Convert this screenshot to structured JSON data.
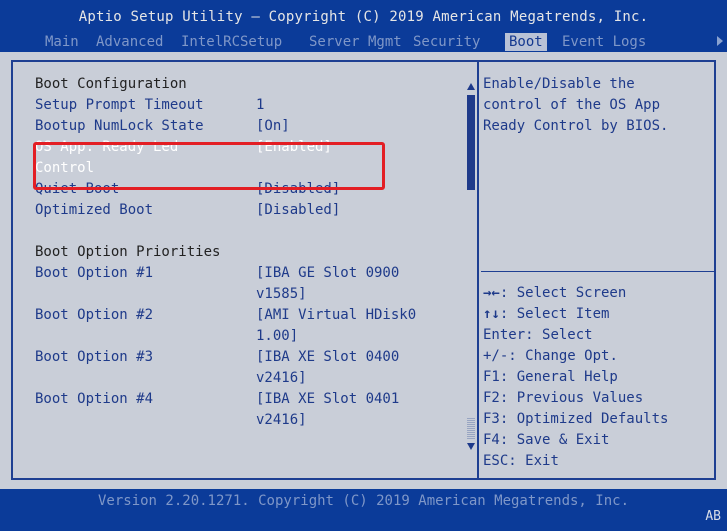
{
  "header": {
    "title": "Aptio Setup Utility – Copyright (C) 2019 American Megatrends, Inc.",
    "tabs": [
      {
        "label": "Main"
      },
      {
        "label": "Advanced"
      },
      {
        "label": "IntelRCSetup"
      },
      {
        "label": "Server Mgmt"
      },
      {
        "label": "Security"
      },
      {
        "label": "Boot"
      },
      {
        "label": "Event Logs"
      }
    ],
    "active_tab": "Boot"
  },
  "boot": {
    "section1_title": "Boot Configuration",
    "items": [
      {
        "label": "Setup Prompt Timeout",
        "value": "1"
      },
      {
        "label": "Bootup NumLock State",
        "value": "[On]"
      },
      {
        "label": "OS App. Ready Led",
        "label2": "Control",
        "value": "[Enabled]"
      },
      {
        "label": "Quiet Boot",
        "value": "[Disabled]"
      },
      {
        "label": "Optimized Boot",
        "value": "[Disabled]"
      }
    ],
    "section2_title": "Boot Option Priorities",
    "options": [
      {
        "label": "Boot Option #1",
        "value": "[IBA GE Slot 0900",
        "value2": "v1585]"
      },
      {
        "label": "Boot Option #2",
        "value": "[AMI Virtual HDisk0",
        "value2": "1.00]"
      },
      {
        "label": "Boot Option #3",
        "value": "[IBA XE Slot 0400",
        "value2": "v2416]"
      },
      {
        "label": "Boot Option #4",
        "value": "[IBA XE Slot 0401",
        "value2": "v2416]"
      }
    ]
  },
  "help": {
    "lines": [
      "Enable/Disable the",
      "control of the OS App",
      "Ready Control by BIOS."
    ],
    "keys": [
      {
        "key": "→←",
        "text": ": Select Screen"
      },
      {
        "key": "↑↓",
        "text": ": Select Item"
      },
      {
        "key": "Enter",
        "text": ": Select"
      },
      {
        "key": "+/-",
        "text": ": Change Opt."
      },
      {
        "key": "F1",
        "text": ": General Help"
      },
      {
        "key": "F2",
        "text": ": Previous Values"
      },
      {
        "key": "F3",
        "text": ": Optimized Defaults"
      },
      {
        "key": "F4",
        "text": ": Save & Exit"
      },
      {
        "key": "ESC",
        "text": ": Exit"
      }
    ]
  },
  "footer": {
    "version": "Version 2.20.1271. Copyright (C) 2019 American Megatrends, Inc.",
    "code": "AB"
  }
}
